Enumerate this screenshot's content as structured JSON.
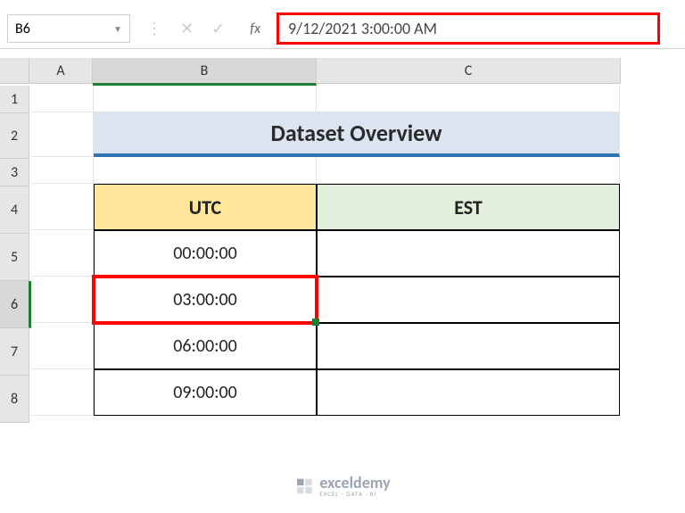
{
  "nameBox": "B6",
  "formulaValue": "9/12/2021  3:00:00 AM",
  "fxLabel": "fx",
  "columns": {
    "A": "A",
    "B": "B",
    "C": "C"
  },
  "rows": {
    "1": "1",
    "2": "2",
    "3": "3",
    "4": "4",
    "5": "5",
    "6": "6",
    "7": "7",
    "8": "8"
  },
  "title": "Dataset Overview",
  "headers": {
    "utc": "UTC",
    "est": "EST"
  },
  "data": {
    "r5": {
      "utc": "00:00:00",
      "est": ""
    },
    "r6": {
      "utc": "03:00:00",
      "est": ""
    },
    "r7": {
      "utc": "06:00:00",
      "est": ""
    },
    "r8": {
      "utc": "09:00:00",
      "est": ""
    }
  },
  "watermark": {
    "main": "exceldemy",
    "sub": "EXCEL · DATA · BI"
  }
}
